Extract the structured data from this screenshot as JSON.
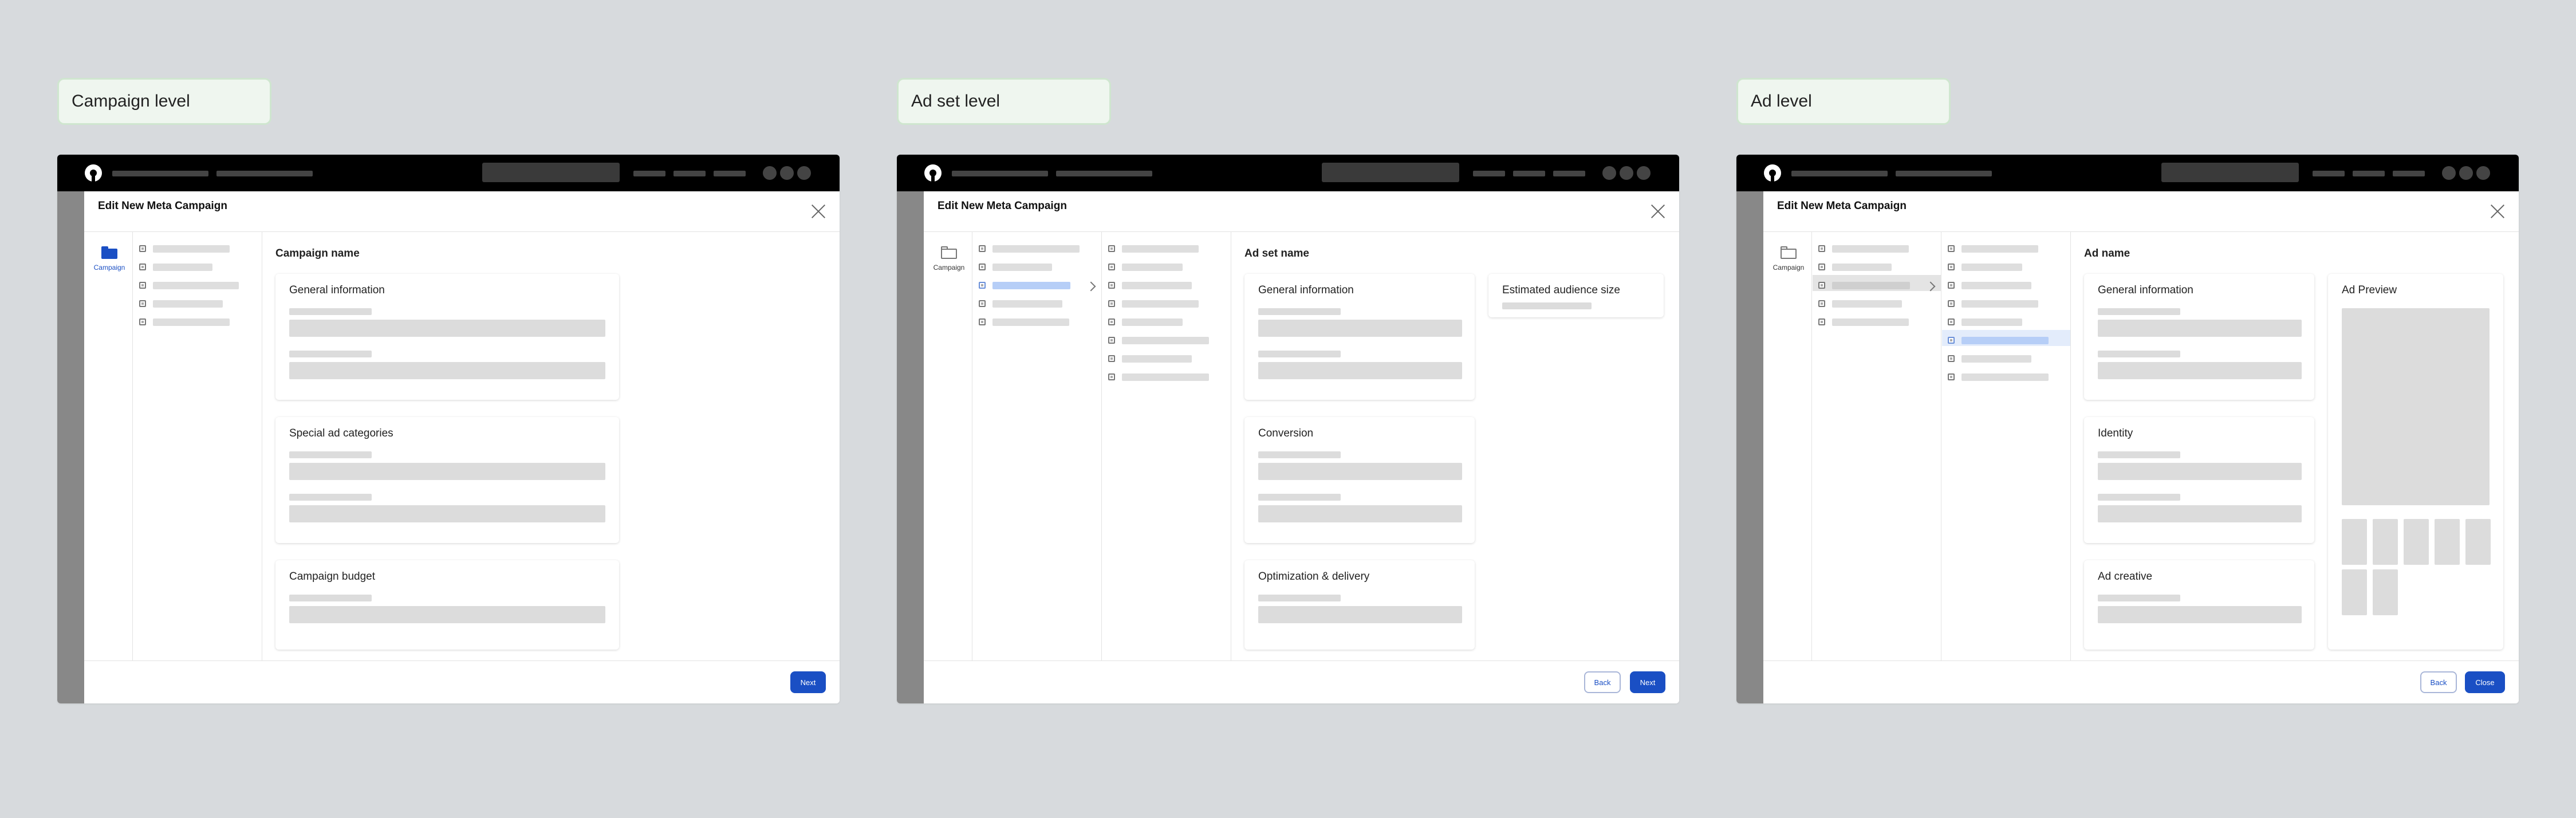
{
  "panels": [
    {
      "level_label": "Campaign level",
      "dialog_title": "Edit New Meta Campaign",
      "sidebar_label": "Campaign",
      "section_title": "Campaign name",
      "cards": [
        "General information",
        "Special ad categories",
        "Campaign budget"
      ],
      "side_card": "",
      "buttons": [
        "Next"
      ]
    },
    {
      "level_label": "Ad set level",
      "dialog_title": "Edit New Meta Campaign",
      "sidebar_label": "Campaign",
      "section_title": "Ad set name",
      "cards": [
        "General information",
        "Conversion",
        "Optimization & delivery"
      ],
      "side_card": "Estimated audience size",
      "buttons": [
        "Back",
        "Next"
      ]
    },
    {
      "level_label": "Ad level",
      "dialog_title": "Edit New Meta Campaign",
      "sidebar_label": "Campaign",
      "section_title": "Ad name",
      "cards": [
        "General information",
        "Identity",
        "Ad creative"
      ],
      "side_card": "Ad Preview",
      "buttons": [
        "Back",
        "Close"
      ]
    }
  ],
  "colors": {
    "background": "#d7dadd",
    "label_pill": "#eff6ef",
    "topbar": "#000000",
    "primary_button": "#1a4fc4",
    "selection": "#b6cef7",
    "selection_neutral": "#e4e4e4",
    "active_icon": "#1a4fc4",
    "inactive_icon": "#777777"
  },
  "icons": {
    "campaign": "folder-icon",
    "close": "close-icon",
    "logo": "app-logo-icon",
    "expand": "chevron-right-icon"
  }
}
